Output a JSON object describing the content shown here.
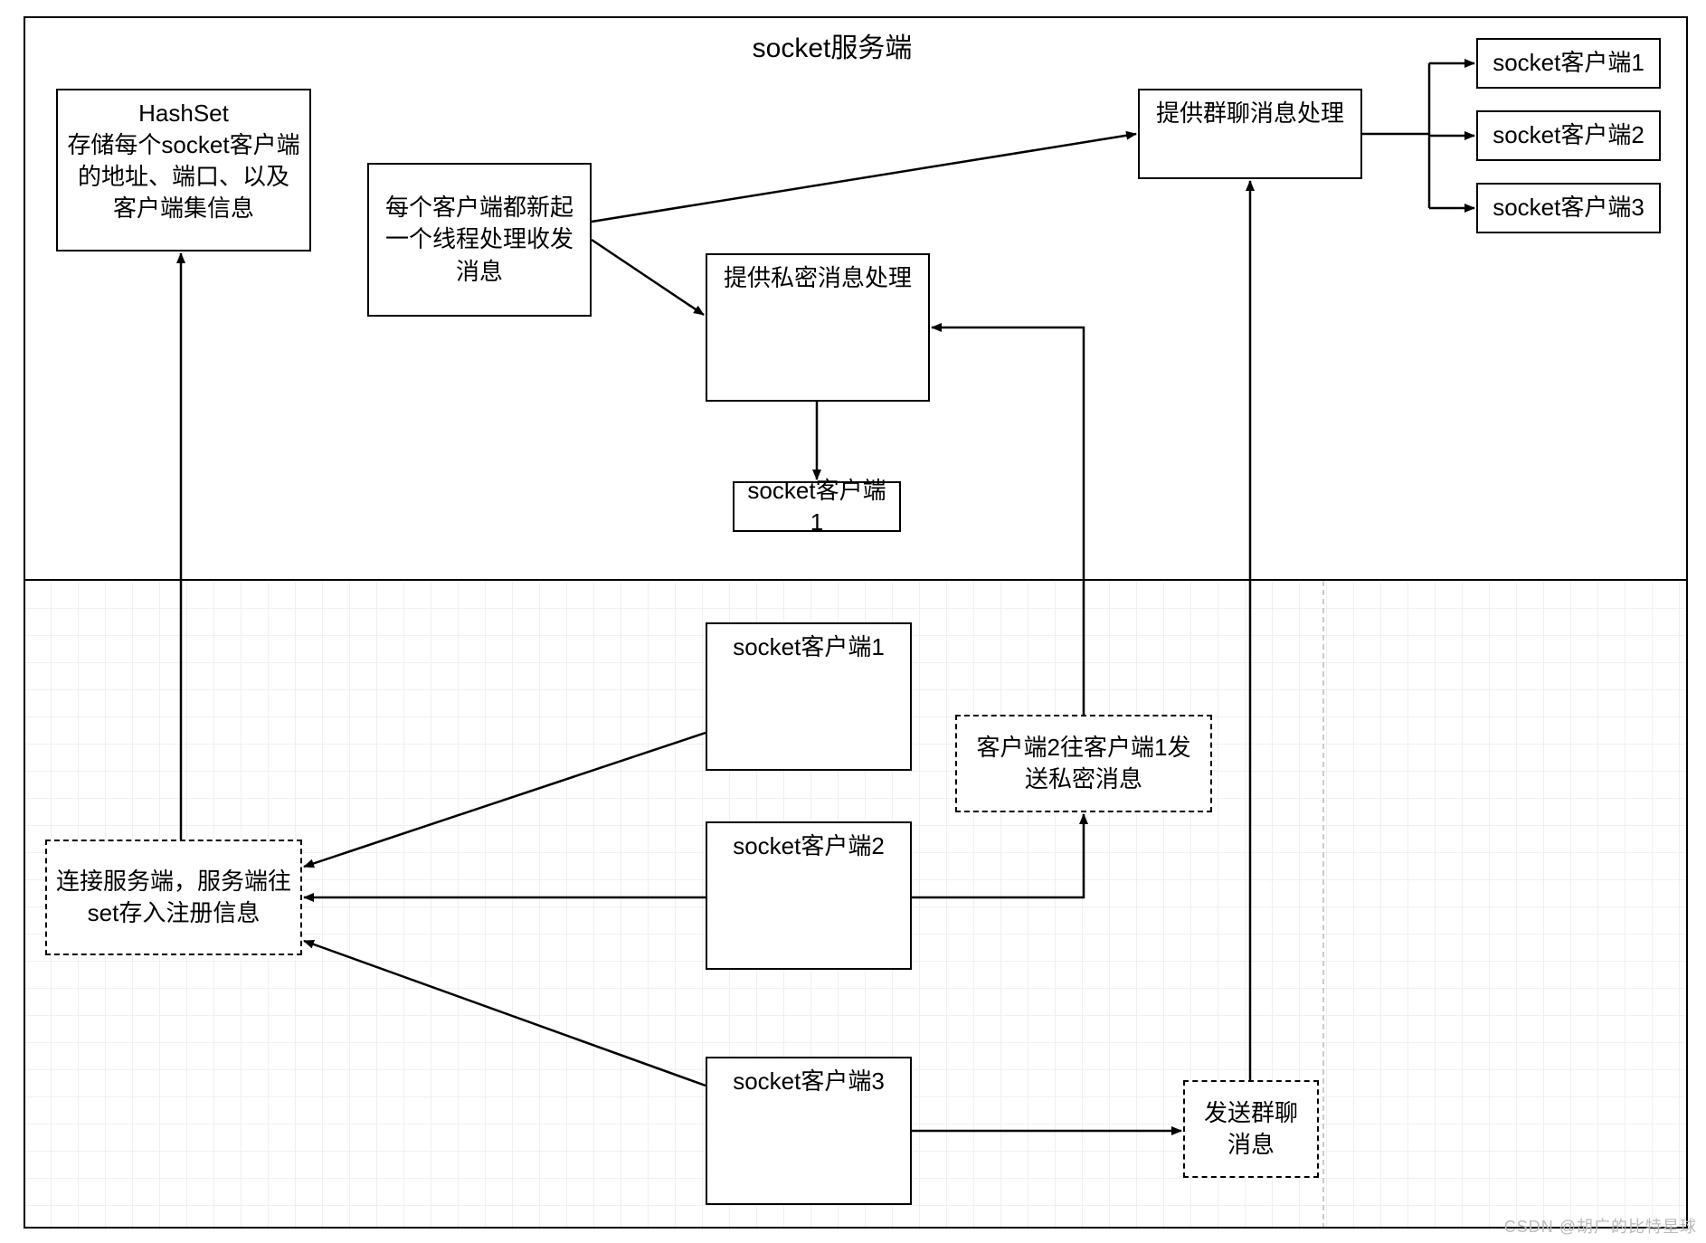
{
  "title": "socket服务端",
  "boxes": {
    "hashset": "HashSet\n存储每个socket客户端的地址、端口、以及客户端集信息",
    "thread": "每个客户端都新起一个线程处理收发消息",
    "private_handler": "提供私密消息处理",
    "group_handler": "提供群聊消息处理",
    "socket_client_1_top": "socket客户端1",
    "right_client_1": "socket客户端1",
    "right_client_2": "socket客户端2",
    "right_client_3": "socket客户端3",
    "lower_client_1": "socket客户端1",
    "lower_client_2": "socket客户端2",
    "lower_client_3": "socket客户端3",
    "connect_register": "连接服务端，服务端往set存入注册信息",
    "private_msg_note": "客户端2往客户端1发送私密消息",
    "group_msg_note": "发送群聊\n消息"
  },
  "watermark": "CSDN @胡广的比特星球"
}
